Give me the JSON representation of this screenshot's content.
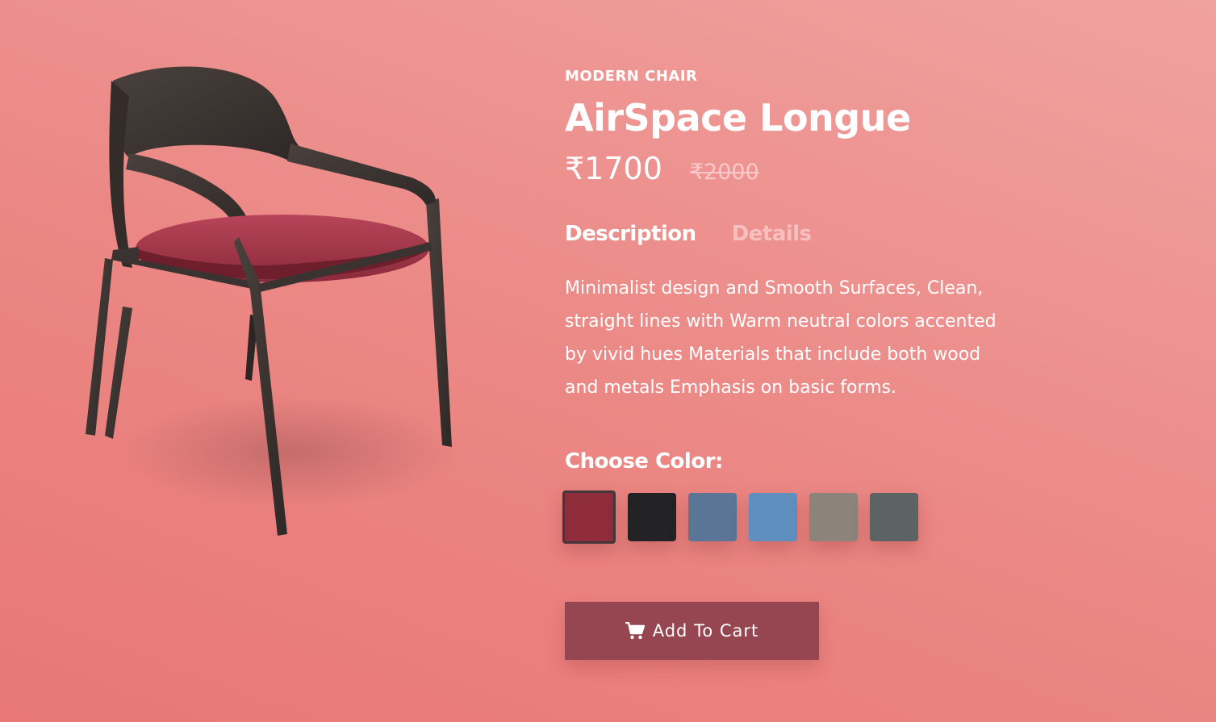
{
  "product": {
    "category": "MODERN CHAIR",
    "name": "AirSpace Longue",
    "price": "₹1700",
    "old_price": "₹2000"
  },
  "tabs": [
    {
      "label": "Description",
      "active": true
    },
    {
      "label": "Details",
      "active": false
    }
  ],
  "description": "Minimalist design and Smooth Surfaces, Clean, straight lines with Warm neutral colors accented by vivid hues Materials that include both wood and metals Emphasis on basic forms.",
  "color_picker": {
    "label": "Choose Color:",
    "swatches": [
      {
        "name": "maroon",
        "color": "#8e2c3c",
        "selected": true
      },
      {
        "name": "black",
        "color": "#232326",
        "selected": false
      },
      {
        "name": "denim-blue",
        "color": "#5a7596",
        "selected": false
      },
      {
        "name": "sky-blue",
        "color": "#5e8fbe",
        "selected": false
      },
      {
        "name": "taupe",
        "color": "#8c837b",
        "selected": false
      },
      {
        "name": "slate-grey",
        "color": "#5d6262",
        "selected": false
      }
    ]
  },
  "cart_button": {
    "label": "Add To Cart",
    "icon": "cart-icon"
  },
  "colors": {
    "background": "#eb8784",
    "button": "#964651",
    "chair_wood": "#3a3331",
    "chair_seat": "#a23848"
  }
}
